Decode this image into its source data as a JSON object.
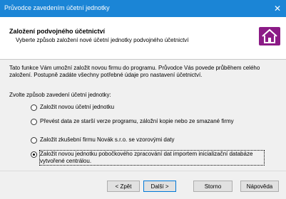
{
  "window": {
    "title": "Průvodce zavedením účetní jednotky",
    "close_icon": "✕"
  },
  "header": {
    "title": "Založení podvojného účetnictví",
    "subtitle": "Vyberte způsob založení nové účetní jednotky podvojného účetnictví",
    "icon": "home-icon",
    "icon_color": "#8b1b86"
  },
  "content": {
    "description": "Tato funkce Vám umožní založit novou firmu do programu. Průvodce Vás povede průběhem celého založení. Postupně zadáte všechny potřebné údaje pro nastavení účetnictví.",
    "prompt": "Zvolte způsob zavedení účetní jednotky:",
    "options": [
      {
        "label": "Založit novou účetní jednotku",
        "selected": false
      },
      {
        "label": "Převést data ze starší verze programu, záložní kopie nebo ze smazané firmy",
        "selected": false
      },
      {
        "label": "Založit zkušební firmu Novák s.r.o. se vzorovými daty",
        "selected": false
      },
      {
        "label": "Založit novou jednotku pobočkového zpracování dat importem inicializační databáze vytvořené centrálou.",
        "selected": true
      }
    ]
  },
  "footer": {
    "back": "< Zpět",
    "next": "Další >",
    "cancel": "Storno",
    "help": "Nápověda"
  },
  "colors": {
    "titlebar": "#1b85d6",
    "accent": "#0078d7"
  }
}
